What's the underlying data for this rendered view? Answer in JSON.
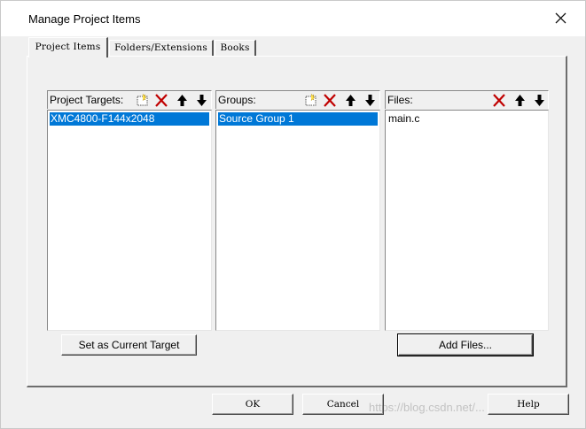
{
  "window": {
    "title": "Manage Project Items",
    "close_icon": "close-icon"
  },
  "tabs": [
    {
      "label": "Project Items",
      "active": true
    },
    {
      "label": "Folders/Extensions",
      "active": false
    },
    {
      "label": "Books",
      "active": false
    }
  ],
  "targets": {
    "label": "Project Targets:",
    "items": [
      "XMC4800-F144x2048"
    ],
    "selected": "XMC4800-F144x2048",
    "toolbar": [
      "new-icon",
      "delete-icon",
      "move-up-icon",
      "move-down-icon"
    ]
  },
  "groups": {
    "label": "Groups:",
    "items": [
      "Source Group 1"
    ],
    "selected": "Source Group 1",
    "toolbar": [
      "new-icon",
      "delete-icon",
      "move-up-icon",
      "move-down-icon"
    ]
  },
  "files": {
    "label": "Files:",
    "items": [
      "main.c"
    ],
    "toolbar": [
      "delete-icon",
      "move-up-icon",
      "move-down-icon"
    ]
  },
  "buttons": {
    "set_current": "Set as Current Target",
    "add_files": "Add Files...",
    "ok": "OK",
    "cancel": "Cancel",
    "help": "Help"
  },
  "watermark": "https://blog.csdn.net/...",
  "colors": {
    "selection": "#0078d7",
    "dialog_bg": "#f0f0f0",
    "delete_x": "#c00000"
  }
}
